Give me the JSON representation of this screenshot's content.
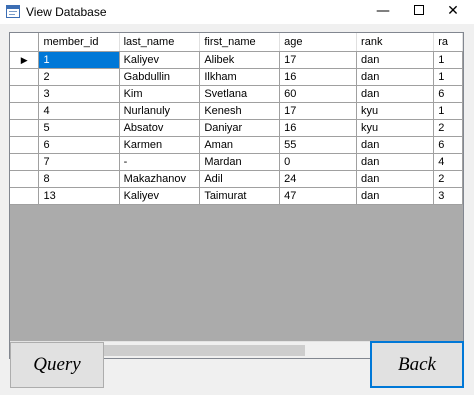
{
  "window": {
    "title": "View Database",
    "minimize_glyph": "—",
    "close_glyph": "✕"
  },
  "grid": {
    "columns": [
      "member_id",
      "last_name",
      "first_name",
      "age",
      "rank",
      "ra"
    ],
    "current_row_marker": "▶",
    "rows": [
      [
        "1",
        "Kaliyev",
        "Alibek",
        "17",
        "dan",
        "1"
      ],
      [
        "2",
        "Gabdullin",
        "Ilkham",
        "16",
        "dan",
        "1"
      ],
      [
        "3",
        "Kim",
        "Svetlana",
        "60",
        "dan",
        "6"
      ],
      [
        "4",
        "Nurlanuly",
        "Kenesh",
        "17",
        "kyu",
        "1"
      ],
      [
        "5",
        "Absatov",
        "Daniyar",
        "16",
        "kyu",
        "2"
      ],
      [
        "6",
        "Karmen",
        "Aman",
        "55",
        "dan",
        "6"
      ],
      [
        "7",
        "-",
        "Mardan",
        "0",
        "dan",
        "4"
      ],
      [
        "8",
        "Makazhanov",
        "Adil",
        "24",
        "dan",
        "2"
      ],
      [
        "13",
        "Kaliyev",
        "Taimurat",
        "47",
        "dan",
        "3"
      ]
    ],
    "scroll_left_glyph": "<",
    "scroll_right_glyph": ">"
  },
  "buttons": {
    "query": "Query",
    "back": "Back"
  },
  "colors": {
    "selection": "#0078d7",
    "grid_background": "#ababab",
    "form_background": "#f0f0f0"
  }
}
